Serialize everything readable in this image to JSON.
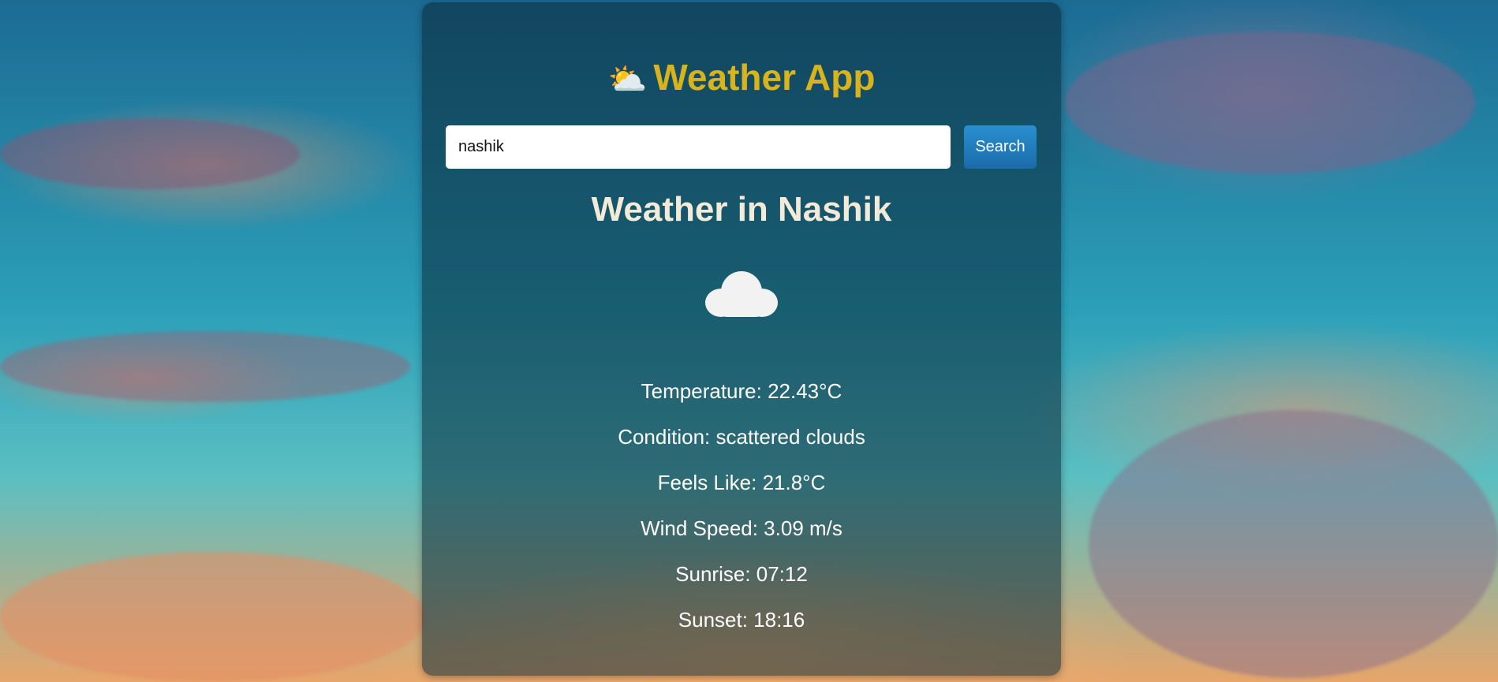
{
  "app": {
    "title_icon": "sun-behind-cloud-icon",
    "title_emoji": "⛅",
    "title": "Weather App",
    "title_color": "#d8b31c"
  },
  "search": {
    "value": "nashik",
    "button_label": "Search",
    "button_color": "#1f7dbd"
  },
  "weather": {
    "heading": "Weather in Nashik",
    "icon": "cloud-icon",
    "temperature": "Temperature: 22.43°C",
    "condition": "Condition: scattered clouds",
    "feels_like": "Feels Like: 21.8°C",
    "wind_speed": "Wind Speed: 3.09 m/s",
    "sunrise": "Sunrise: 07:12",
    "sunset": "Sunset: 18:16"
  }
}
